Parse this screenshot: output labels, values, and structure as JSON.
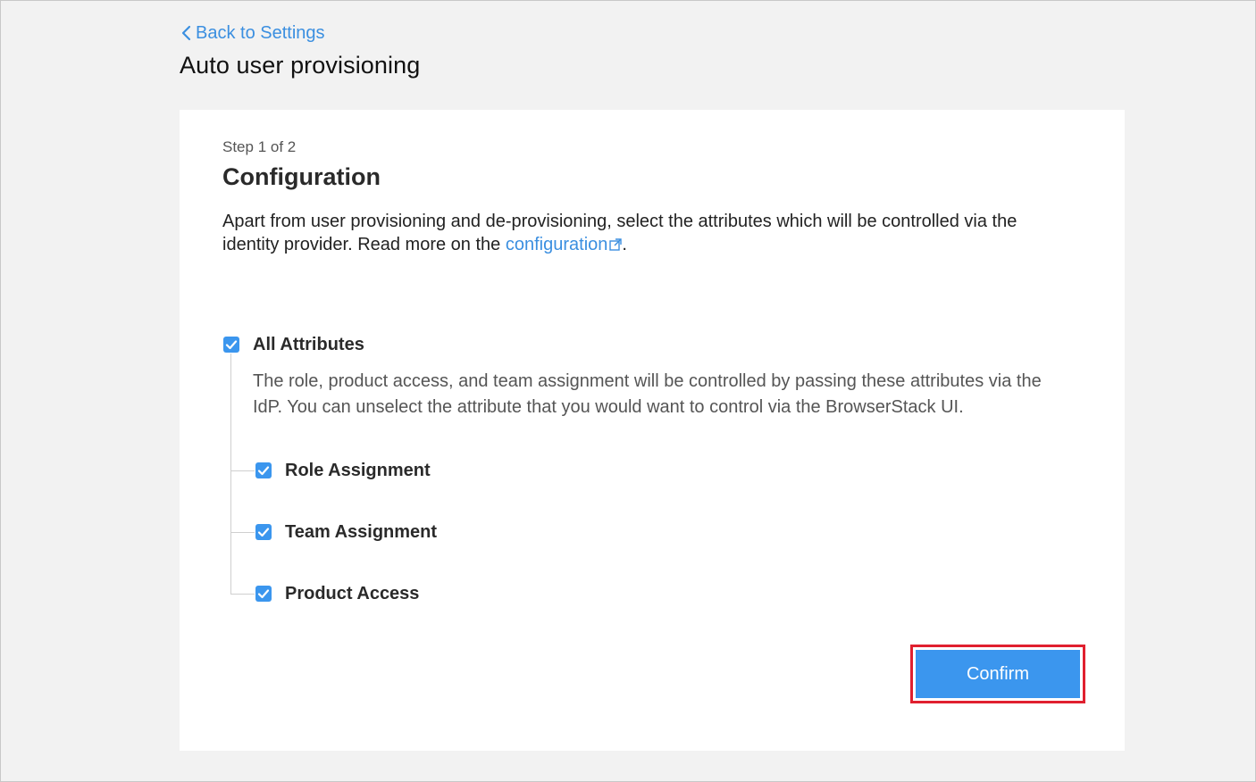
{
  "header": {
    "back_label": "Back to Settings",
    "title": "Auto user provisioning"
  },
  "step": {
    "indicator": "Step 1 of 2",
    "title": "Configuration",
    "description_prefix": "Apart from user provisioning and de-provisioning, select the attributes which will be controlled via the identity provider. Read more on the ",
    "description_link": "configuration",
    "description_suffix": "."
  },
  "attributes": {
    "all": {
      "label": "All Attributes",
      "checked": true,
      "description": "The role, product access, and team assignment will be controlled by passing these attributes via the IdP. You can unselect the attribute that you would want to control via the BrowserStack UI."
    },
    "items": [
      {
        "label": "Role Assignment",
        "checked": true
      },
      {
        "label": "Team Assignment",
        "checked": true
      },
      {
        "label": "Product Access",
        "checked": true
      }
    ]
  },
  "actions": {
    "confirm_label": "Confirm"
  },
  "colors": {
    "accent": "#3b96ee",
    "link": "#3b8fe0",
    "highlight_border": "#e0202f",
    "background": "#f2f2f2"
  },
  "icons": {
    "back": "chevron-left-icon",
    "external": "external-link-icon",
    "check": "checkmark-icon"
  }
}
